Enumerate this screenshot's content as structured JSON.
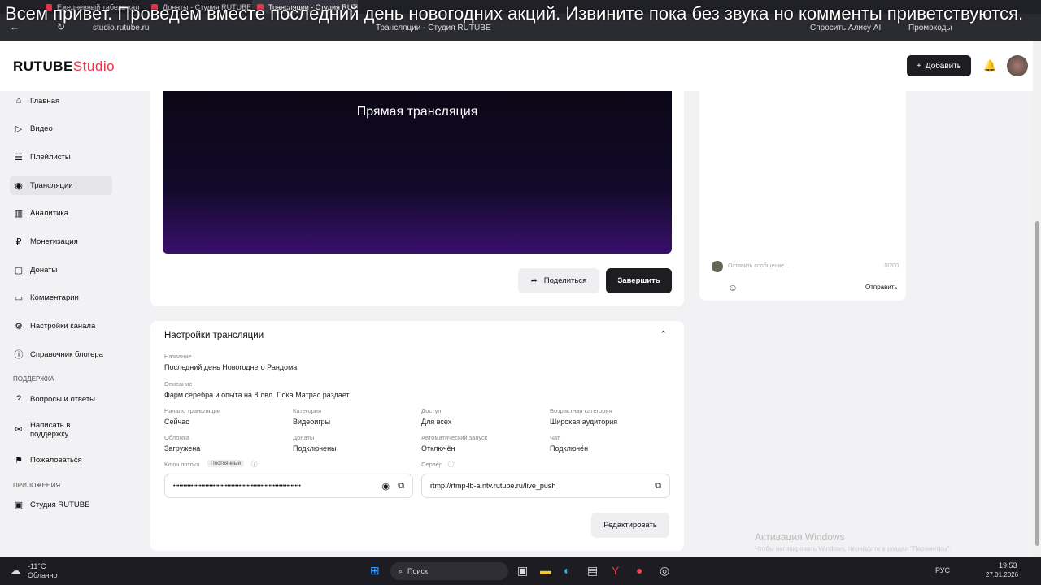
{
  "browser": {
    "tabs": [
      "Ежедневный табель кал",
      "Донаты - Студия RUTUBE",
      "Трансляции - Студия RUTUBE"
    ],
    "url": "studio.rutube.ru",
    "title": "Трансляции - Студия RUTUBE",
    "alice": "Спросить Алису AI",
    "promo": "Промокоды"
  },
  "subtitle": "Всем привет. Проведем вместе последний день новогодних акций. Извините пока без звука но комменты приветствуются.",
  "header": {
    "logo_main": "RUTUBE",
    "logo_sub": "Studio",
    "add": "Добавить"
  },
  "sidebar": {
    "items": [
      "Главная",
      "Видео",
      "Плейлисты",
      "Трансляции",
      "Аналитика",
      "Монетизация",
      "Донаты",
      "Комментарии",
      "Настройки канала",
      "Справочник блогера"
    ],
    "support_title": "ПОДДЕРЖКА",
    "support": [
      "Вопросы и ответы",
      "Написать в поддержку",
      "Пожаловаться"
    ],
    "apps_title": "ПРИЛОЖЕНИЯ",
    "apps": [
      "Студия RUTUBE"
    ]
  },
  "player": {
    "title": "Прямая трансляция",
    "share": "Поделиться",
    "finish": "Завершить"
  },
  "chat": {
    "placeholder": "Оставить сообщение...",
    "counter": "0/200",
    "send": "Отправить"
  },
  "settings": {
    "title": "Настройки трансляции",
    "name_label": "Название",
    "name": "Последний день Новогоднего Рандома",
    "desc_label": "Описание",
    "desc": "Фарм серебра и опыта на 8 лвл. Пока Матрас раздает.",
    "grid": [
      {
        "label": "Начало трансляции",
        "value": "Сейчас"
      },
      {
        "label": "Категория",
        "value": "Видеоигры"
      },
      {
        "label": "Доступ",
        "value": "Для всех"
      },
      {
        "label": "Возрастная категория",
        "value": "Широкая аудитория"
      },
      {
        "label": "Обложка",
        "value": "Загружена"
      },
      {
        "label": "Донаты",
        "value": "Подключены"
      },
      {
        "label": "Автоматический запуск",
        "value": "Отключён"
      },
      {
        "label": "Чат",
        "value": "Подключён"
      }
    ],
    "key_label": "Ключ потока",
    "key_badge": "Постоянный",
    "key_value": "••••••••••••••••••••••••••••••••••••••••••••••••••••••••••••••••",
    "server_label": "Сервер",
    "server": "rtmp://rtmp-lb-a.ntv.rutube.ru/live_push",
    "edit": "Редактировать"
  },
  "watermark": {
    "title": "Активация Windows",
    "text": "Чтобы активировать Windows, перейдите в раздел \"Параметры\"."
  },
  "taskbar": {
    "temp": "-11°C",
    "weather": "Облачно",
    "search": "Поиск",
    "lang": "РУС",
    "time": "19:53",
    "date": "27.01.2026"
  }
}
